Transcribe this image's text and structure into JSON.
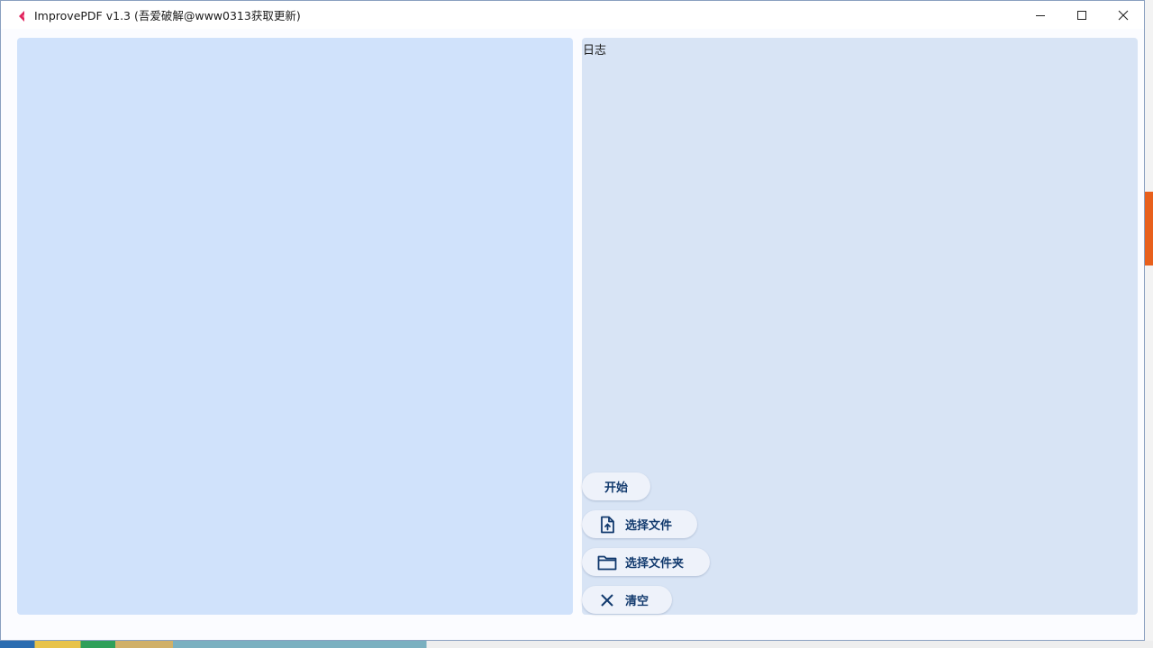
{
  "window": {
    "title": "ImprovePDF v1.3 (吾爱破解@www0313获取更新)"
  },
  "titlebar_controls": {
    "minimize_icon": "minimize-icon",
    "maximize_icon": "maximize-icon",
    "close_icon": "close-icon"
  },
  "log_panel": {
    "label": "日志"
  },
  "actions": {
    "start_label": "开始",
    "select_file_label": "选择文件",
    "select_folder_label": "选择文件夹",
    "clear_label": "清空"
  },
  "colors": {
    "accent": "#123a6e",
    "left_panel": "#d0e2fb",
    "right_panel": "#d8e4f5"
  }
}
